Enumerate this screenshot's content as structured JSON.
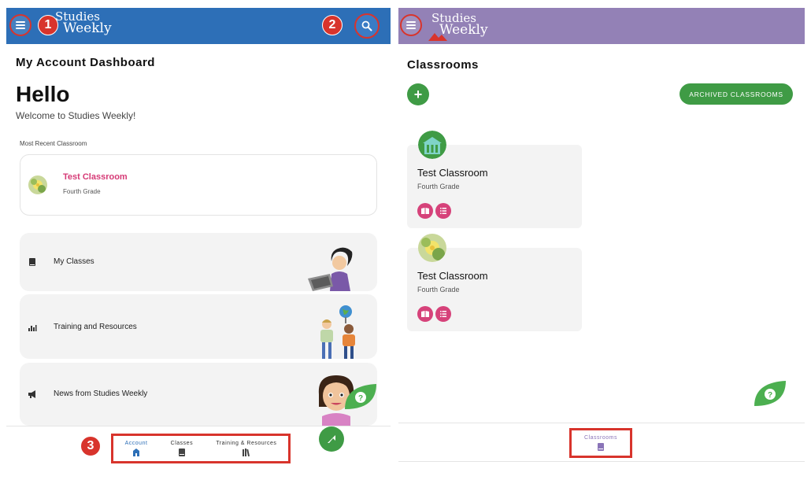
{
  "left": {
    "logo": {
      "line1": "Studies",
      "line2": "Weekly"
    },
    "badges": {
      "one": "1",
      "two": "2",
      "three": "3"
    },
    "page_title": "My Account Dashboard",
    "greeting": "Hello",
    "welcome": "Welcome to Studies Weekly!",
    "recent_label": "Most Recent Classroom",
    "recent_classroom": {
      "name": "Test Classroom",
      "grade": "Fourth Grade"
    },
    "menu_items": [
      {
        "label": "My Classes",
        "icon": "book-icon"
      },
      {
        "label": "Training and Resources",
        "icon": "chart-icon"
      },
      {
        "label": "News from Studies Weekly",
        "icon": "megaphone-icon"
      }
    ],
    "bottom_nav": [
      {
        "label": "Account",
        "icon": "account-icon",
        "active": true
      },
      {
        "label": "Classes",
        "icon": "book-icon",
        "active": false
      },
      {
        "label": "Training & Resources",
        "icon": "library-icon",
        "active": false
      }
    ],
    "colors": {
      "header": "#2d6fb7",
      "accent_pink": "#d63a76",
      "green": "#3f9b45",
      "highlight_red": "#d8342c"
    }
  },
  "right": {
    "logo": {
      "line1": "Studies",
      "line2": "Weekly"
    },
    "page_title": "Classrooms",
    "add_label": "+",
    "archived_label": "ARCHIVED CLASSROOMS",
    "classrooms": [
      {
        "name": "Test Classroom",
        "grade": "Fourth Grade",
        "avatar": "building-icon"
      },
      {
        "name": "Test Classroom",
        "grade": "Fourth Grade",
        "avatar": "flower-image"
      }
    ],
    "bottom_nav": [
      {
        "label": "Classrooms",
        "icon": "book-icon",
        "active": true
      }
    ],
    "colors": {
      "header": "#9381b6",
      "pill": "#d6427a",
      "green": "#3f9b45"
    }
  }
}
